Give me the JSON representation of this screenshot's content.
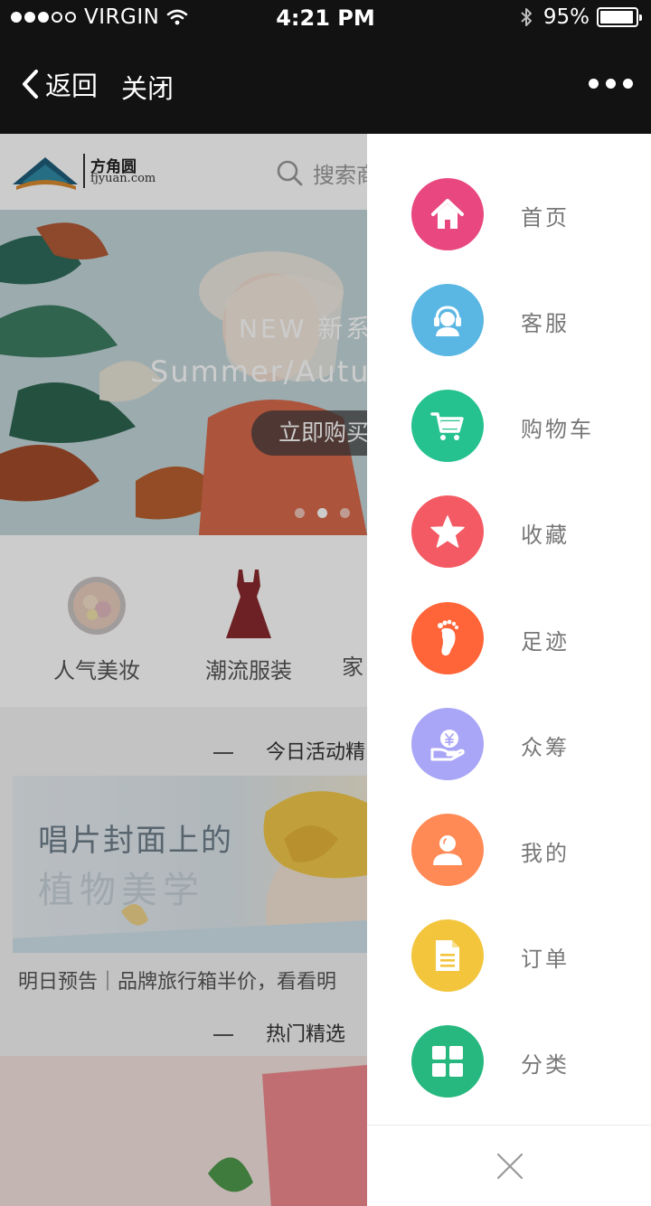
{
  "status_bar": {
    "carrier": "VIRGIN",
    "time": "4:21 PM",
    "battery_text": "95%",
    "battery_level": 0.95
  },
  "nav_bar": {
    "back_label": "返回",
    "close_label": "关闭"
  },
  "background_page": {
    "logo_cn": "方角圆",
    "logo_en": "fjyuan.com",
    "search_placeholder": "搜索商",
    "banner": {
      "line1": "NEW 新系",
      "line2": "Summer/Autu",
      "cta": "立即购买"
    },
    "categories": [
      {
        "label": "人气美妆"
      },
      {
        "label": "潮流服装"
      },
      {
        "label": "家"
      }
    ],
    "section_today": "今日活动精",
    "promo": {
      "title1": "唱片封面上的",
      "title2": "植物美学",
      "caption": "明日预告｜品牌旅行箱半价，看看明"
    },
    "section_hot": "热门精选"
  },
  "drawer": {
    "items": [
      {
        "label": "首页",
        "icon": "home-icon",
        "color": "#e8487f"
      },
      {
        "label": "客服",
        "icon": "customer-service-icon",
        "color": "#5ab7e3"
      },
      {
        "label": "购物车",
        "icon": "cart-icon",
        "color": "#25c18f"
      },
      {
        "label": "收藏",
        "icon": "star-icon",
        "color": "#f35a63"
      },
      {
        "label": "足迹",
        "icon": "footprint-icon",
        "color": "#ff6538"
      },
      {
        "label": "众筹",
        "icon": "crowdfunding-icon",
        "color": "#a9a5f7"
      },
      {
        "label": "我的",
        "icon": "user-icon",
        "color": "#ff8a55"
      },
      {
        "label": "订单",
        "icon": "order-icon",
        "color": "#f2c53d"
      },
      {
        "label": "分类",
        "icon": "category-icon",
        "color": "#27b87f"
      }
    ]
  }
}
